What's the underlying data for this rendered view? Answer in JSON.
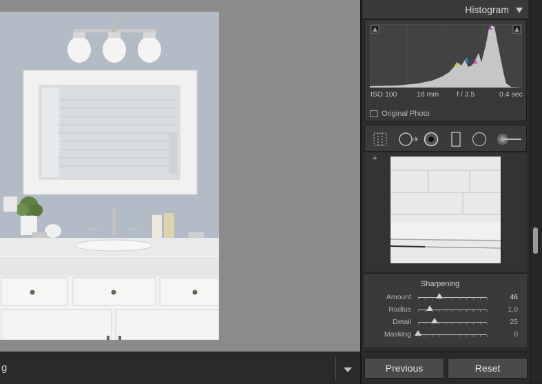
{
  "histogram": {
    "title": "Histogram",
    "iso": "ISO 100",
    "focal_length": "18 mm",
    "aperture": "f / 3.5",
    "shutter": "0.4 sec",
    "original_photo_label": "Original Photo"
  },
  "filmstrip": {
    "label": "g"
  },
  "sharpening": {
    "title": "Sharpening",
    "sliders": [
      {
        "label": "Amount",
        "value": "46",
        "fraction": 0.31
      },
      {
        "label": "Radius",
        "value": "1.0",
        "fraction": 0.17
      },
      {
        "label": "Detail",
        "value": "25",
        "fraction": 0.24
      },
      {
        "label": "Masking",
        "value": "0",
        "fraction": 0.0
      }
    ]
  },
  "buttons": {
    "previous": "Previous",
    "reset": "Reset"
  },
  "colors": {
    "canvas_bg": "#8b8b8b",
    "panel_bg": "#2c2c2c",
    "section_bg": "#3a3a3a"
  },
  "icons": [
    "crop-overlay-icon",
    "spot-removal-icon",
    "red-eye-icon",
    "graduated-filter-icon",
    "radial-filter-icon",
    "adjustment-brush-icon"
  ]
}
